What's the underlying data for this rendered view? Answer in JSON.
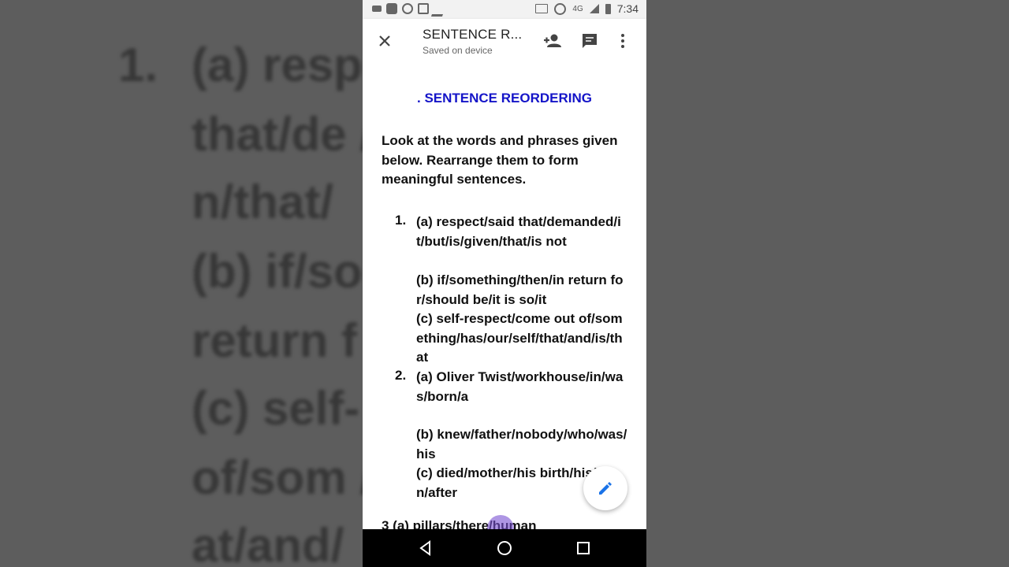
{
  "status_bar": {
    "time": "7:34",
    "network": "4G"
  },
  "app_bar": {
    "title": "SENTENCE R...",
    "subtitle": "Saved on device"
  },
  "document": {
    "heading": ". SENTENCE REORDERING",
    "heading_color": "#1414c8",
    "intro": "Look at the words and phrases given below. Rearrange them to form meaningful sentences.",
    "questions": [
      {
        "number": "1.",
        "parts": [
          "(a) respect/said that/demanded/it/but/is/given/that/is not",
          "(b) if/something/then/in return for/should be/it is so/it",
          "(c) self-respect/come out of/something/has/our/self/that/and/is/that"
        ]
      },
      {
        "number": "2.",
        "parts": [
          "(a) Oliver Twist/workhouse/in/was/born/a",
          "(b) knew/father/nobody/who/was/his",
          "(c) died/mother/his birth/his/soon/after"
        ]
      }
    ],
    "partial_line": "3 (a) pillars/there/human"
  },
  "background": {
    "number": "1.",
    "lines": [
      "(a) resp",
      "that/de                /but/is/give",
      "n/that/",
      "(b) if/so                    hen/in",
      "return f                 be/it is so/it",
      "(c) self-                 me out",
      "of/som                /our/self/th",
      "at/and/"
    ]
  },
  "icons": {
    "close": "close-icon",
    "add_person": "add-person-icon",
    "comment": "comment-icon",
    "more": "more-vert-icon",
    "edit": "edit-pencil-icon",
    "back": "back-triangle-icon",
    "home": "home-circle-icon",
    "recents": "recents-square-icon"
  },
  "colors": {
    "accent": "#1a73e8",
    "fab_icon": "#1a73e8"
  }
}
